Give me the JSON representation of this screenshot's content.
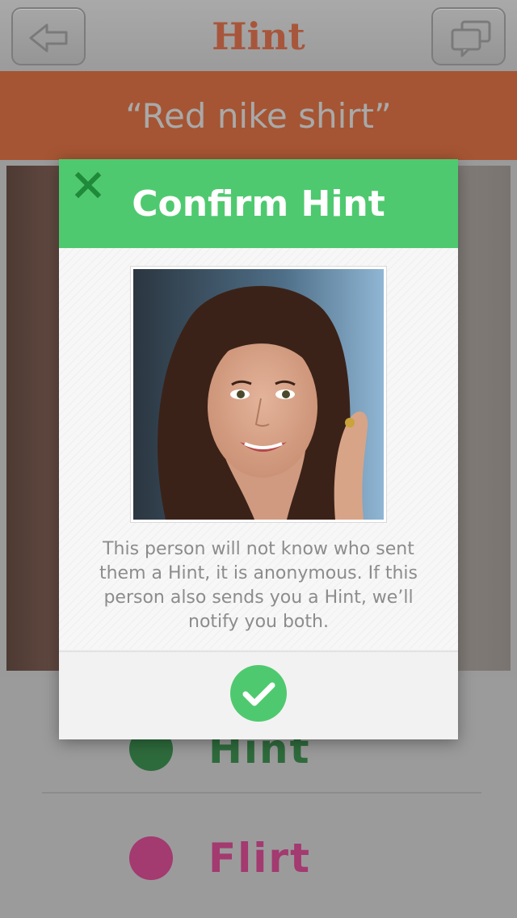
{
  "header": {
    "logo": "Hint",
    "back_icon": "back-arrow-icon",
    "chat_icon": "chat-bubbles-icon"
  },
  "prompt": {
    "text": "“Red nike shirt”"
  },
  "choices": [
    {
      "label": "Hint",
      "color": "#2e6b3c",
      "icon": "hint-leaf-icon"
    },
    {
      "label": "Flirt",
      "color": "#a33a70",
      "icon": "flirt-leaf-icon"
    }
  ],
  "modal": {
    "title": "Confirm Hint",
    "close_icon": "close-x-icon",
    "message": "This person will not know who sent them a Hint, it is anonymous. If this person also sends you a Hint, we’ll notify you both.",
    "confirm_icon": "checkmark-icon"
  },
  "colors": {
    "brand_green": "#4fc96f",
    "brand_orange": "#a55533",
    "flirt_pink": "#a33a70"
  }
}
